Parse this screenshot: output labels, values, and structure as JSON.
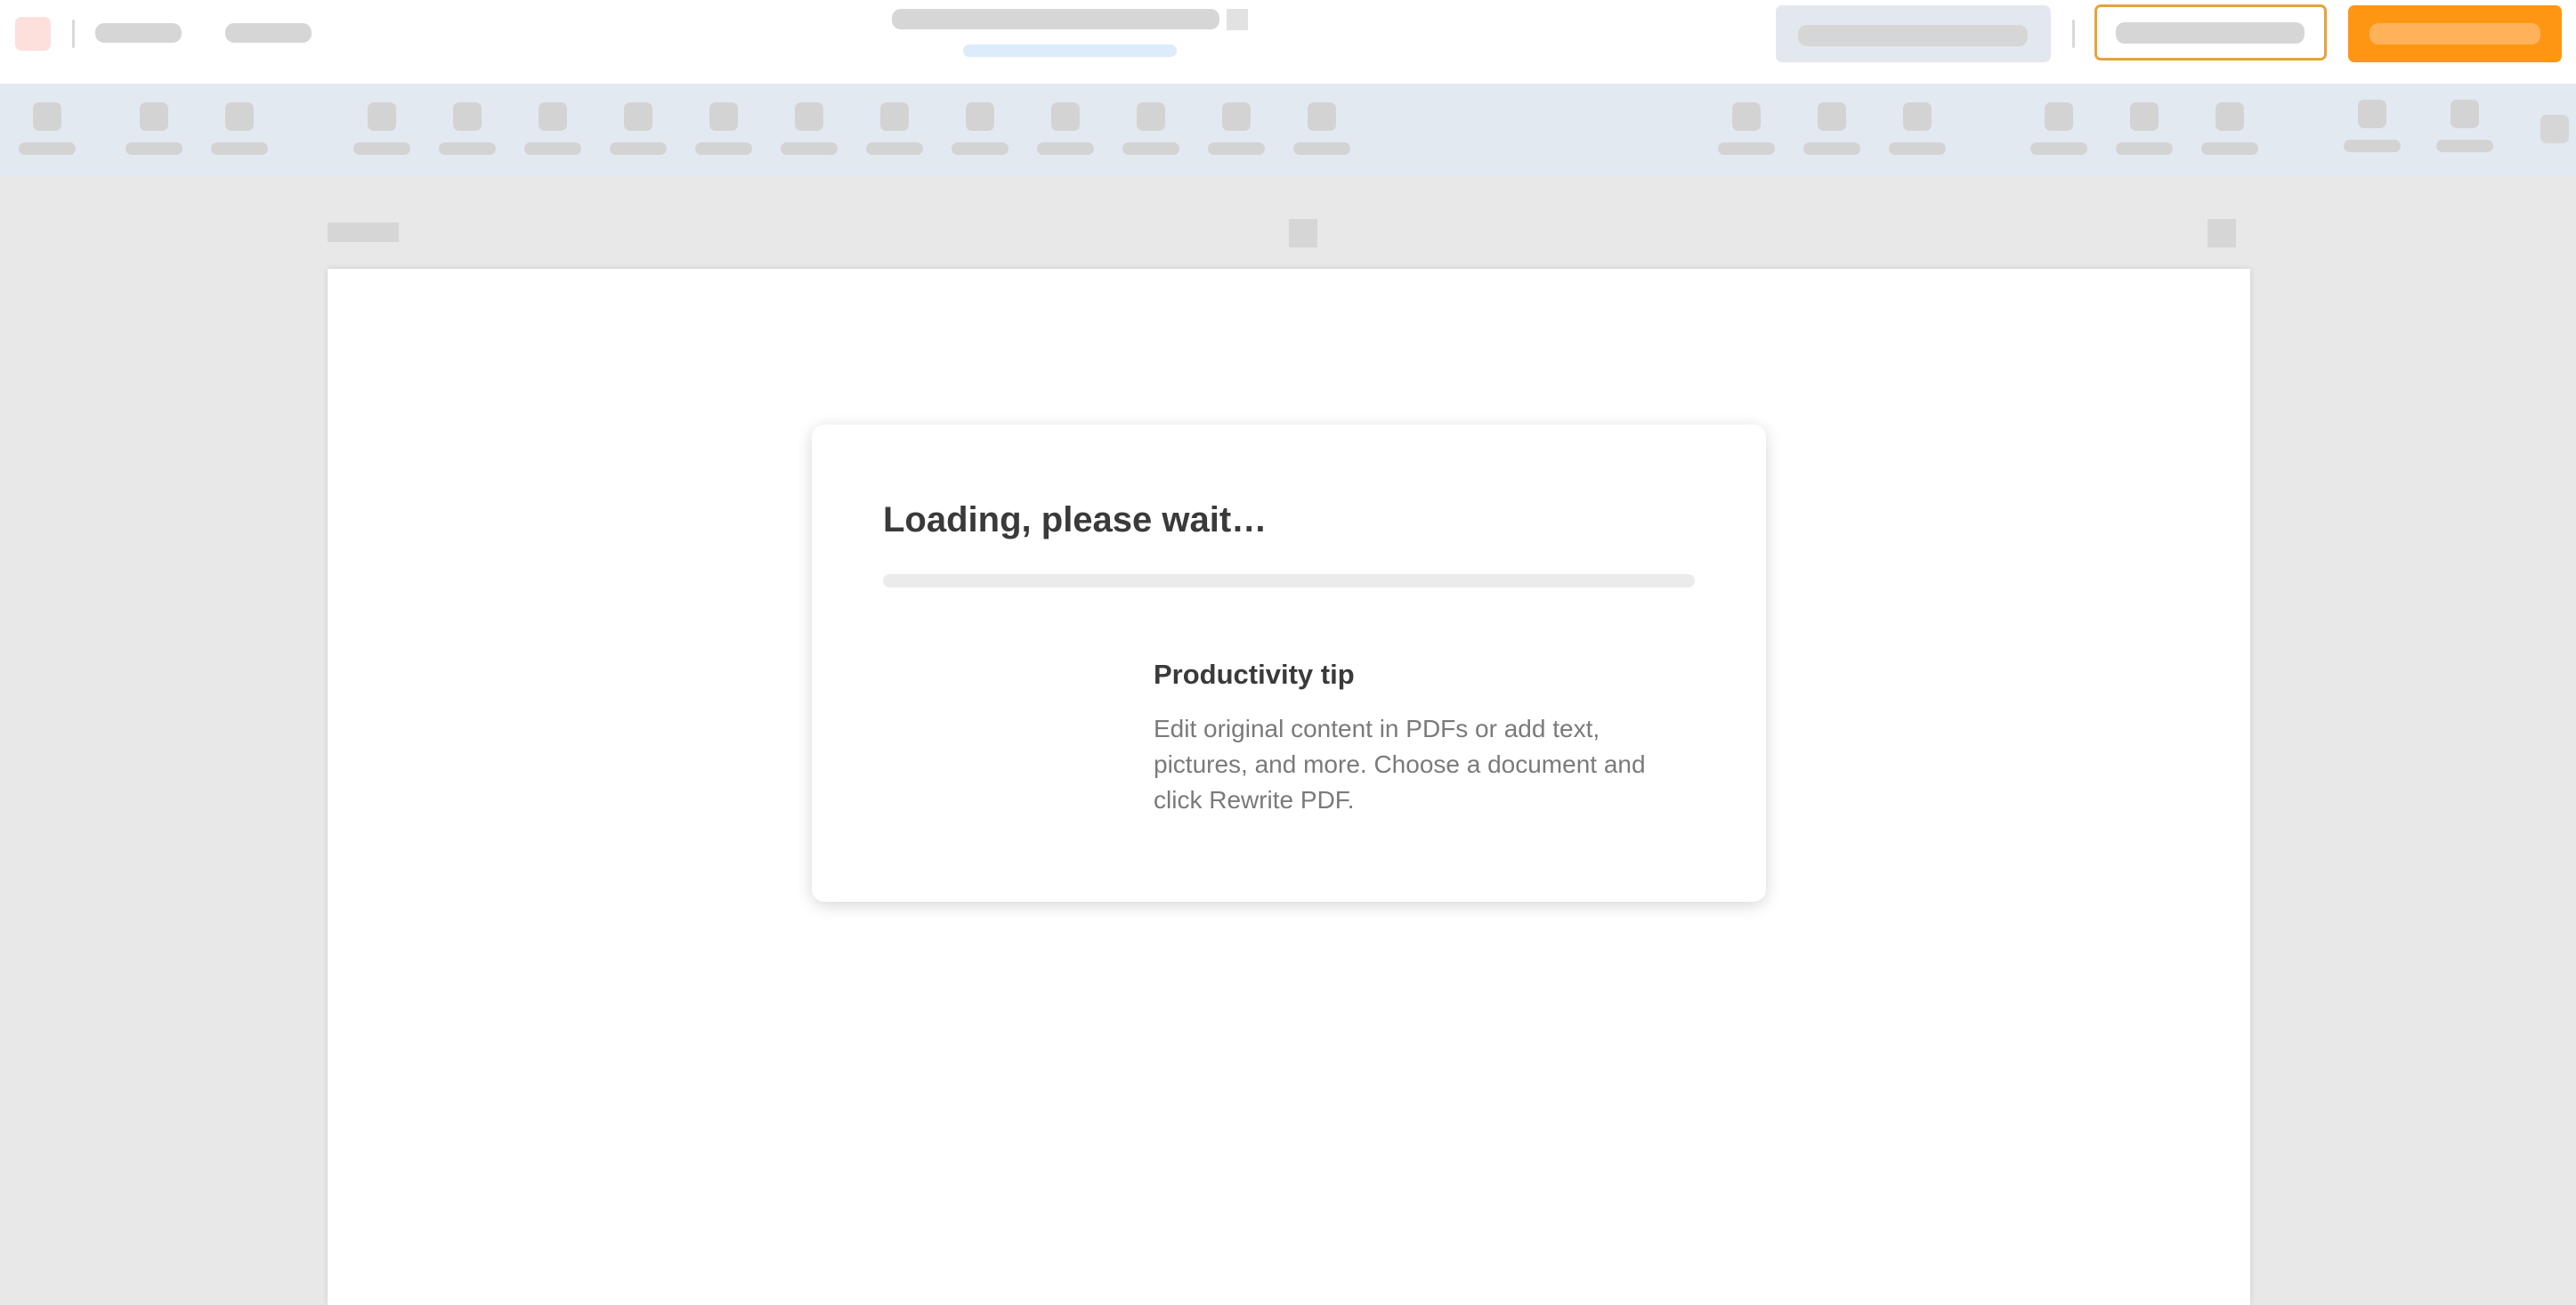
{
  "loading_dialog": {
    "title": "Loading, please wait…",
    "progress": 0,
    "tip_title": "Productivity tip",
    "tip_text": "Edit original content in PDFs or add text, pictures, and more. Choose a document and click Rewrite PDF."
  },
  "colors": {
    "accent": "#ff9613",
    "accent_outline": "#e7a23b",
    "toolbar_bg": "#e3e9f1",
    "workspace_bg": "#e8e8e8",
    "logo_tint": "#fde0dc"
  }
}
